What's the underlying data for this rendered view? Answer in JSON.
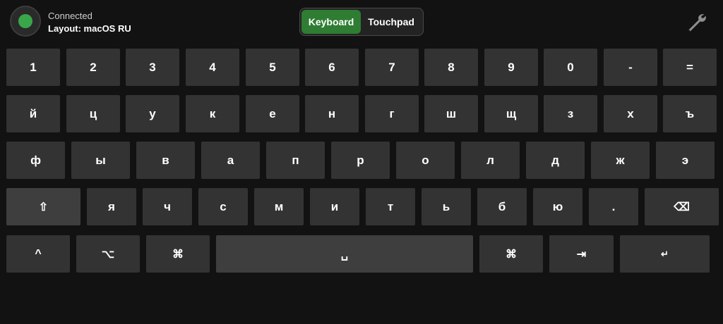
{
  "status": {
    "connection": "Connected",
    "layout": "Layout: macOS RU",
    "indicator_color": "#3aa64a"
  },
  "mode_toggle": {
    "keyboard_label": "Keyboard",
    "touchpad_label": "Touchpad",
    "active": "Keyboard",
    "active_color": "#2e7d32"
  },
  "settings": {
    "icon": "wrench-icon"
  },
  "rows": [
    [
      "1",
      "2",
      "3",
      "4",
      "5",
      "6",
      "7",
      "8",
      "9",
      "0",
      "-",
      "="
    ],
    [
      "й",
      "ц",
      "у",
      "к",
      "е",
      "н",
      "г",
      "ш",
      "щ",
      "з",
      "х",
      "ъ"
    ],
    [
      "ф",
      "ы",
      "в",
      "а",
      "п",
      "р",
      "о",
      "л",
      "д",
      "ж",
      "э"
    ],
    [
      "⇧",
      "я",
      "ч",
      "с",
      "м",
      "и",
      "т",
      "ь",
      "б",
      "ю",
      ".",
      "⌫"
    ],
    [
      "^",
      "⌥",
      "⌘",
      "␣",
      "⌘",
      "⇥",
      "↵"
    ]
  ]
}
